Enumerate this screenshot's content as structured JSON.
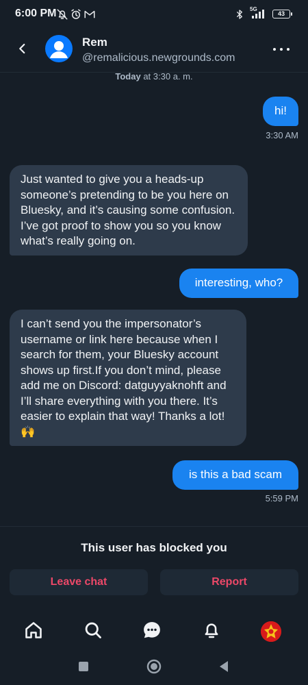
{
  "status_bar": {
    "time": "6:00 PM",
    "network": "5G",
    "battery": "43",
    "icons": [
      "mute-notifications-icon",
      "alarm-icon",
      "gmail-icon",
      "bluetooth-icon",
      "signal-icon",
      "battery-icon"
    ]
  },
  "header": {
    "name": "Rem",
    "handle": "@remalicious.newgrounds.com",
    "back_icon": "back-chevron-icon",
    "more_icon": "more-dots-icon"
  },
  "date_separator": {
    "day": "Today",
    "rest": " at 3:30 a. m."
  },
  "messages": [
    {
      "from": "me",
      "text": "hi!",
      "time": "3:30 AM"
    },
    {
      "from": "them",
      "text": "Just wanted to give you a heads-up someone’s pretending to be you here on Bluesky, and it’s causing some confusion. I’ve got proof to show you so you know what’s really going on."
    },
    {
      "from": "me",
      "text": "interesting, who?"
    },
    {
      "from": "them",
      "text": "I can’t send you the impersonator’s username or link here because when I search for them, your Bluesky account shows up first.If you don’t mind, please add me on Discord: datguyyaknohft and I’ll share everything with you there. It’s easier to explain that way! Thanks a lot! 🙌"
    },
    {
      "from": "me",
      "text": "is this a bad scam",
      "time": "5:59 PM"
    }
  ],
  "blocked": {
    "notice": "This user has blocked you",
    "leave_label": "Leave chat",
    "report_label": "Report"
  },
  "bottom_nav": [
    "home-icon",
    "search-icon",
    "chat-icon",
    "notifications-icon",
    "profile-avatar"
  ],
  "system_nav": [
    "recents-button",
    "home-button",
    "back-button"
  ],
  "colors": {
    "background": "#161e27",
    "my_bubble": "#1a83f0",
    "their_bubble": "#2e3b4b",
    "danger": "#ec4868",
    "muted_text": "#aebbc9"
  }
}
